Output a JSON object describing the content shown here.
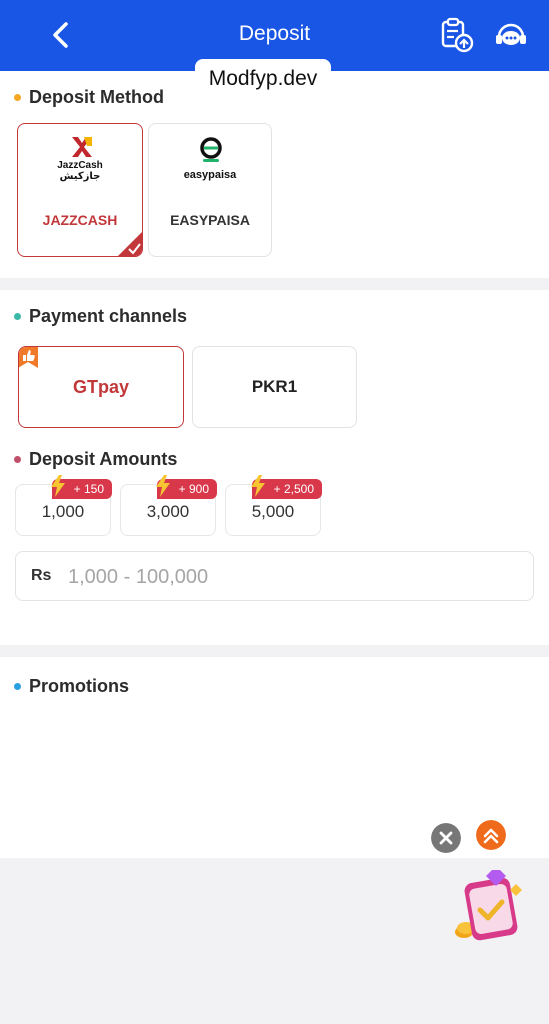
{
  "header": {
    "title": "Deposit",
    "back_icon": "chevron-left-icon",
    "history_icon": "clipboard-upload-icon",
    "support_icon": "headset-chat-icon"
  },
  "watermark": "Modfyp.dev",
  "deposit_method": {
    "title": "Deposit Method",
    "dot_color": "#f5a623",
    "methods": [
      {
        "label": "JAZZCASH",
        "logo_line1": "JazzCash",
        "logo_line2": "جازکیش",
        "selected": true
      },
      {
        "label": "EASYPAISA",
        "logo_text": "easypaisa",
        "selected": false
      }
    ]
  },
  "payment_channels": {
    "title": "Payment channels",
    "dot_color": "#3cb8a8",
    "channels": [
      {
        "label": "GTpay",
        "selected": true
      },
      {
        "label": "PKR1",
        "selected": false
      }
    ]
  },
  "deposit_amounts": {
    "title": "Deposit Amounts",
    "dot_color": "#c0506a",
    "options": [
      {
        "value": "1,000",
        "bonus": "+ 150"
      },
      {
        "value": "3,000",
        "bonus": "+ 900"
      },
      {
        "value": "5,000",
        "bonus": "+ 2,500"
      }
    ]
  },
  "amount_input": {
    "currency": "Rs",
    "placeholder": "1,000 - 100,000"
  },
  "promotions": {
    "title": "Promotions",
    "dot_color": "#2aa0e0"
  },
  "colors": {
    "header": "#1a56e6",
    "accent_red": "#c2383a",
    "bonus_red": "#d9384a"
  }
}
